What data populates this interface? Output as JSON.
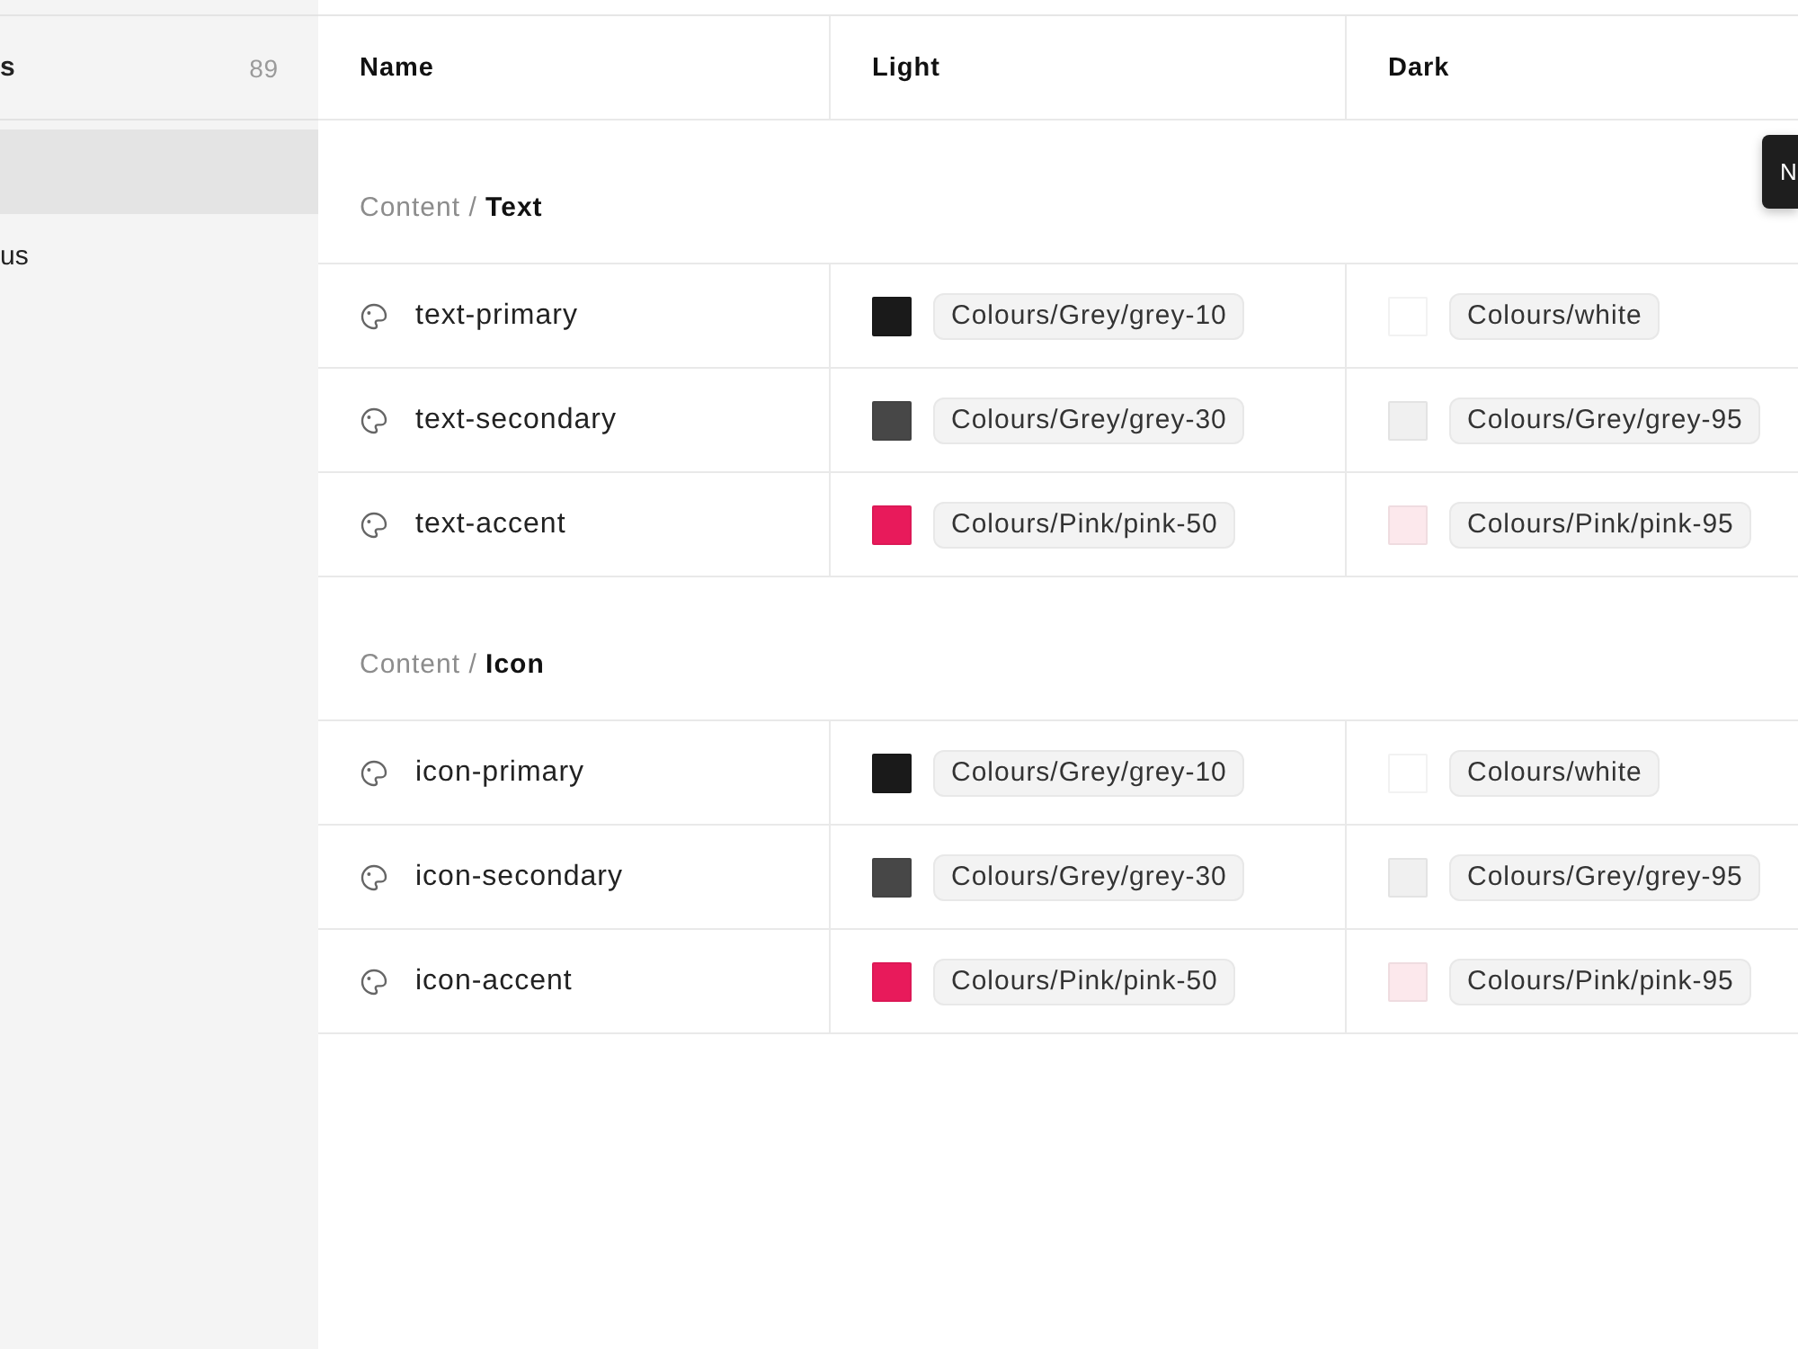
{
  "sidebar": {
    "header": {
      "label": "s",
      "count": "89"
    },
    "items": [
      {
        "selected": true
      },
      {
        "label": "us",
        "selected": false
      }
    ]
  },
  "table": {
    "columns": [
      "Name",
      "Light",
      "Dark"
    ],
    "groups": [
      {
        "title": "Content / **Text**",
        "rows": [
          {
            "name": "text-primary",
            "light": {
              "token": "Colours/Grey/grey-10",
              "color": "#1a1a1a"
            },
            "dark": {
              "token": "Colours/white",
              "color": "#ffffff"
            }
          },
          {
            "name": "text-secondary",
            "light": {
              "token": "Colours/Grey/grey-30",
              "color": "#474747"
            },
            "dark": {
              "token": "Colours/Grey/grey-95",
              "color": "#f0f0f0"
            }
          },
          {
            "name": "text-accent",
            "light": {
              "token": "Colours/Pink/pink-50",
              "color": "#e81a5b"
            },
            "dark": {
              "token": "Colours/Pink/pink-95",
              "color": "#fce8ec"
            }
          }
        ]
      },
      {
        "title": "Content / **Icon**",
        "rows": [
          {
            "name": "icon-primary",
            "light": {
              "token": "Colours/Grey/grey-10",
              "color": "#1a1a1a"
            },
            "dark": {
              "token": "Colours/white",
              "color": "#ffffff"
            }
          },
          {
            "name": "icon-secondary",
            "light": {
              "token": "Colours/Grey/grey-30",
              "color": "#474747"
            },
            "dark": {
              "token": "Colours/Grey/grey-95",
              "color": "#f0f0f0"
            }
          },
          {
            "name": "icon-accent",
            "light": {
              "token": "Colours/Pink/pink-50",
              "color": "#e81a5b"
            },
            "dark": {
              "token": "Colours/Pink/pink-95",
              "color": "#fce8ec"
            }
          }
        ]
      }
    ]
  },
  "tooltip": {
    "text": "N"
  }
}
